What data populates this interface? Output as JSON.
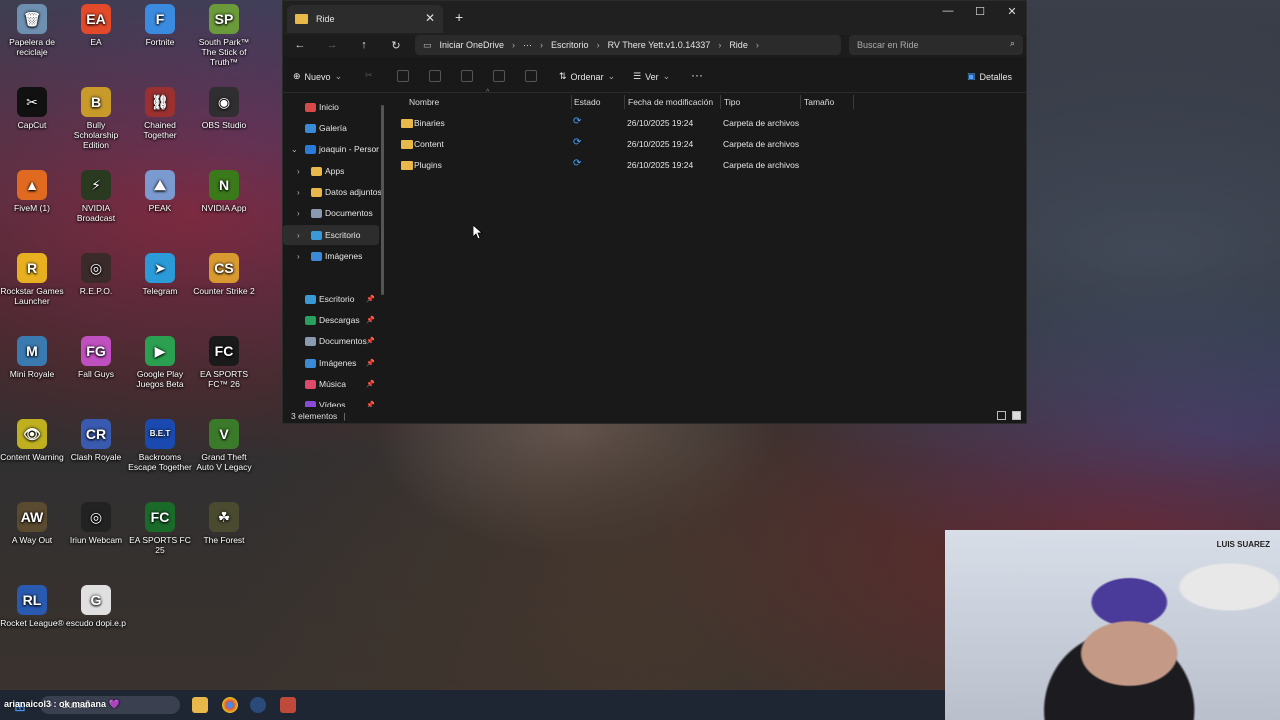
{
  "desktop": {
    "icons": [
      {
        "label": "Papelera de reciclaje",
        "color": "#6e8fb0",
        "glyph": "🗑"
      },
      {
        "label": "EA",
        "color": "#e24a2a",
        "glyph": "EA"
      },
      {
        "label": "Fortnite",
        "color": "#3a8be0",
        "glyph": "F"
      },
      {
        "label": "South Park™ The Stick of Truth™",
        "color": "#6b9a3a",
        "glyph": "SP"
      },
      {
        "label": "CapCut",
        "color": "#111111",
        "glyph": "✂"
      },
      {
        "label": "Bully Scholarship Edition",
        "color": "#c79a2a",
        "glyph": "B"
      },
      {
        "label": "Chained Together",
        "color": "#9a3030",
        "glyph": "⛓"
      },
      {
        "label": "OBS Studio",
        "color": "#302e31",
        "glyph": "◉"
      },
      {
        "label": "FiveM (1)",
        "color": "#e06a20",
        "glyph": "▲"
      },
      {
        "label": "NVIDIA Broadcast",
        "color": "#2a3a20",
        "glyph": "⚡"
      },
      {
        "label": "PEAK",
        "color": "#7a9ad0",
        "glyph": "⛰"
      },
      {
        "label": "NVIDIA App",
        "color": "#3a7a1a",
        "glyph": "N"
      },
      {
        "label": "Rockstar Games Launcher",
        "color": "#e8b020",
        "glyph": "R"
      },
      {
        "label": "R.E.P.O.",
        "color": "#3a2a2a",
        "glyph": "◎"
      },
      {
        "label": "Telegram",
        "color": "#2a9ad8",
        "glyph": "➤"
      },
      {
        "label": "Counter Strike 2",
        "color": "#d89a30",
        "glyph": "CS"
      },
      {
        "label": "Mini Royale",
        "color": "#3a7ab0",
        "glyph": "M"
      },
      {
        "label": "Fall Guys",
        "color": "#c050c0",
        "glyph": "FG"
      },
      {
        "label": "Google Play Juegos Beta",
        "color": "#2aa050",
        "glyph": "▶"
      },
      {
        "label": "EA SPORTS FC™ 26",
        "color": "#1a1a1a",
        "glyph": "FC"
      },
      {
        "label": "Content Warning",
        "color": "#c0b020",
        "glyph": "👁"
      },
      {
        "label": "Clash Royale",
        "color": "#3a5ab0",
        "glyph": "CR"
      },
      {
        "label": "Backrooms Escape Together",
        "color": "#1a4ab0",
        "glyph": "B.E.T"
      },
      {
        "label": "Grand Theft Auto V Legacy",
        "color": "#3a7a2a",
        "glyph": "V"
      },
      {
        "label": "A Way Out",
        "color": "#5a4a30",
        "glyph": "AW"
      },
      {
        "label": "Iriun Webcam",
        "color": "#222222",
        "glyph": "◎"
      },
      {
        "label": "EA SPORTS FC 25",
        "color": "#1a6a2a",
        "glyph": "FC"
      },
      {
        "label": "The Forest",
        "color": "#4a4a30",
        "glyph": "☘"
      },
      {
        "label": "Rocket League®",
        "color": "#2a5ab0",
        "glyph": "RL"
      },
      {
        "label": "escudo dopi.e.p",
        "color": "#e0e0e0",
        "glyph": "G"
      }
    ]
  },
  "window": {
    "tab_title": "Ride",
    "controls": {
      "minimize": "—",
      "maximize": "☐",
      "close": "✕",
      "tab_close": "✕",
      "new_tab": "+"
    },
    "nav": {
      "back": "←",
      "forward": "→",
      "up": "↑",
      "refresh": "↻"
    },
    "breadcrumb": [
      "Iniciar OneDrive",
      "Escritorio",
      "RV There Yett.v1.0.14337",
      "Ride"
    ],
    "breadcrumb_more": "···",
    "search_placeholder": "Buscar en Ride",
    "toolbar": {
      "new": "Nuevo",
      "sort": "Ordenar",
      "view": "Ver",
      "more": "···",
      "details": "Detalles"
    },
    "sidebar": [
      {
        "label": "Inicio",
        "indent": 0,
        "arrow": "",
        "color": "#d84a4a",
        "pin": ""
      },
      {
        "label": "Galería",
        "indent": 0,
        "arrow": "",
        "color": "#3a8ad8",
        "pin": ""
      },
      {
        "label": "joaquin - Persor",
        "indent": 0,
        "arrow": "⌄",
        "color": "#2a7ad8",
        "pin": ""
      },
      {
        "label": "Apps",
        "indent": 1,
        "arrow": "›",
        "color": "#e8b84a",
        "pin": ""
      },
      {
        "label": "Datos adjuntos",
        "indent": 1,
        "arrow": "›",
        "color": "#e8b84a",
        "pin": ""
      },
      {
        "label": "Documentos",
        "indent": 1,
        "arrow": "›",
        "color": "#8a9ab0",
        "pin": ""
      },
      {
        "label": "Escritorio",
        "indent": 1,
        "arrow": "›",
        "color": "#3a9ad8",
        "pin": "",
        "selected": true
      },
      {
        "label": "Imágenes",
        "indent": 1,
        "arrow": "›",
        "color": "#3a8ad8",
        "pin": ""
      },
      {
        "label": "Escritorio",
        "indent": 0,
        "arrow": "",
        "color": "#3a9ad8",
        "pin": "📌"
      },
      {
        "label": "Descargas",
        "indent": 0,
        "arrow": "",
        "color": "#2aa060",
        "pin": "📌"
      },
      {
        "label": "Documentos",
        "indent": 0,
        "arrow": "",
        "color": "#8a9ab0",
        "pin": "📌"
      },
      {
        "label": "Imágenes",
        "indent": 0,
        "arrow": "",
        "color": "#3a8ad8",
        "pin": "📌"
      },
      {
        "label": "Música",
        "indent": 0,
        "arrow": "",
        "color": "#e04a6a",
        "pin": "📌"
      },
      {
        "label": "Vídeos",
        "indent": 0,
        "arrow": "",
        "color": "#8a4ad8",
        "pin": "📌"
      }
    ],
    "columns": [
      "Nombre",
      "Estado",
      "Fecha de modificación",
      "Tipo",
      "Tamaño"
    ],
    "files": [
      {
        "name": "Binaries",
        "status": "⟳",
        "date": "26/10/2025 19:24",
        "type": "Carpeta de archivos"
      },
      {
        "name": "Content",
        "status": "⟳",
        "date": "26/10/2025 19:24",
        "type": "Carpeta de archivos"
      },
      {
        "name": "Plugins",
        "status": "⟳",
        "date": "26/10/2025 19:24",
        "type": "Carpeta de archivos"
      }
    ],
    "status_text": "3 elementos"
  },
  "taskbar": {
    "search_placeholder": "Buscar",
    "chat_overlay": "arianaicol3 : ok mañana 💜"
  },
  "webcam": {
    "shirt_text": "LUIS SUAREZ"
  }
}
